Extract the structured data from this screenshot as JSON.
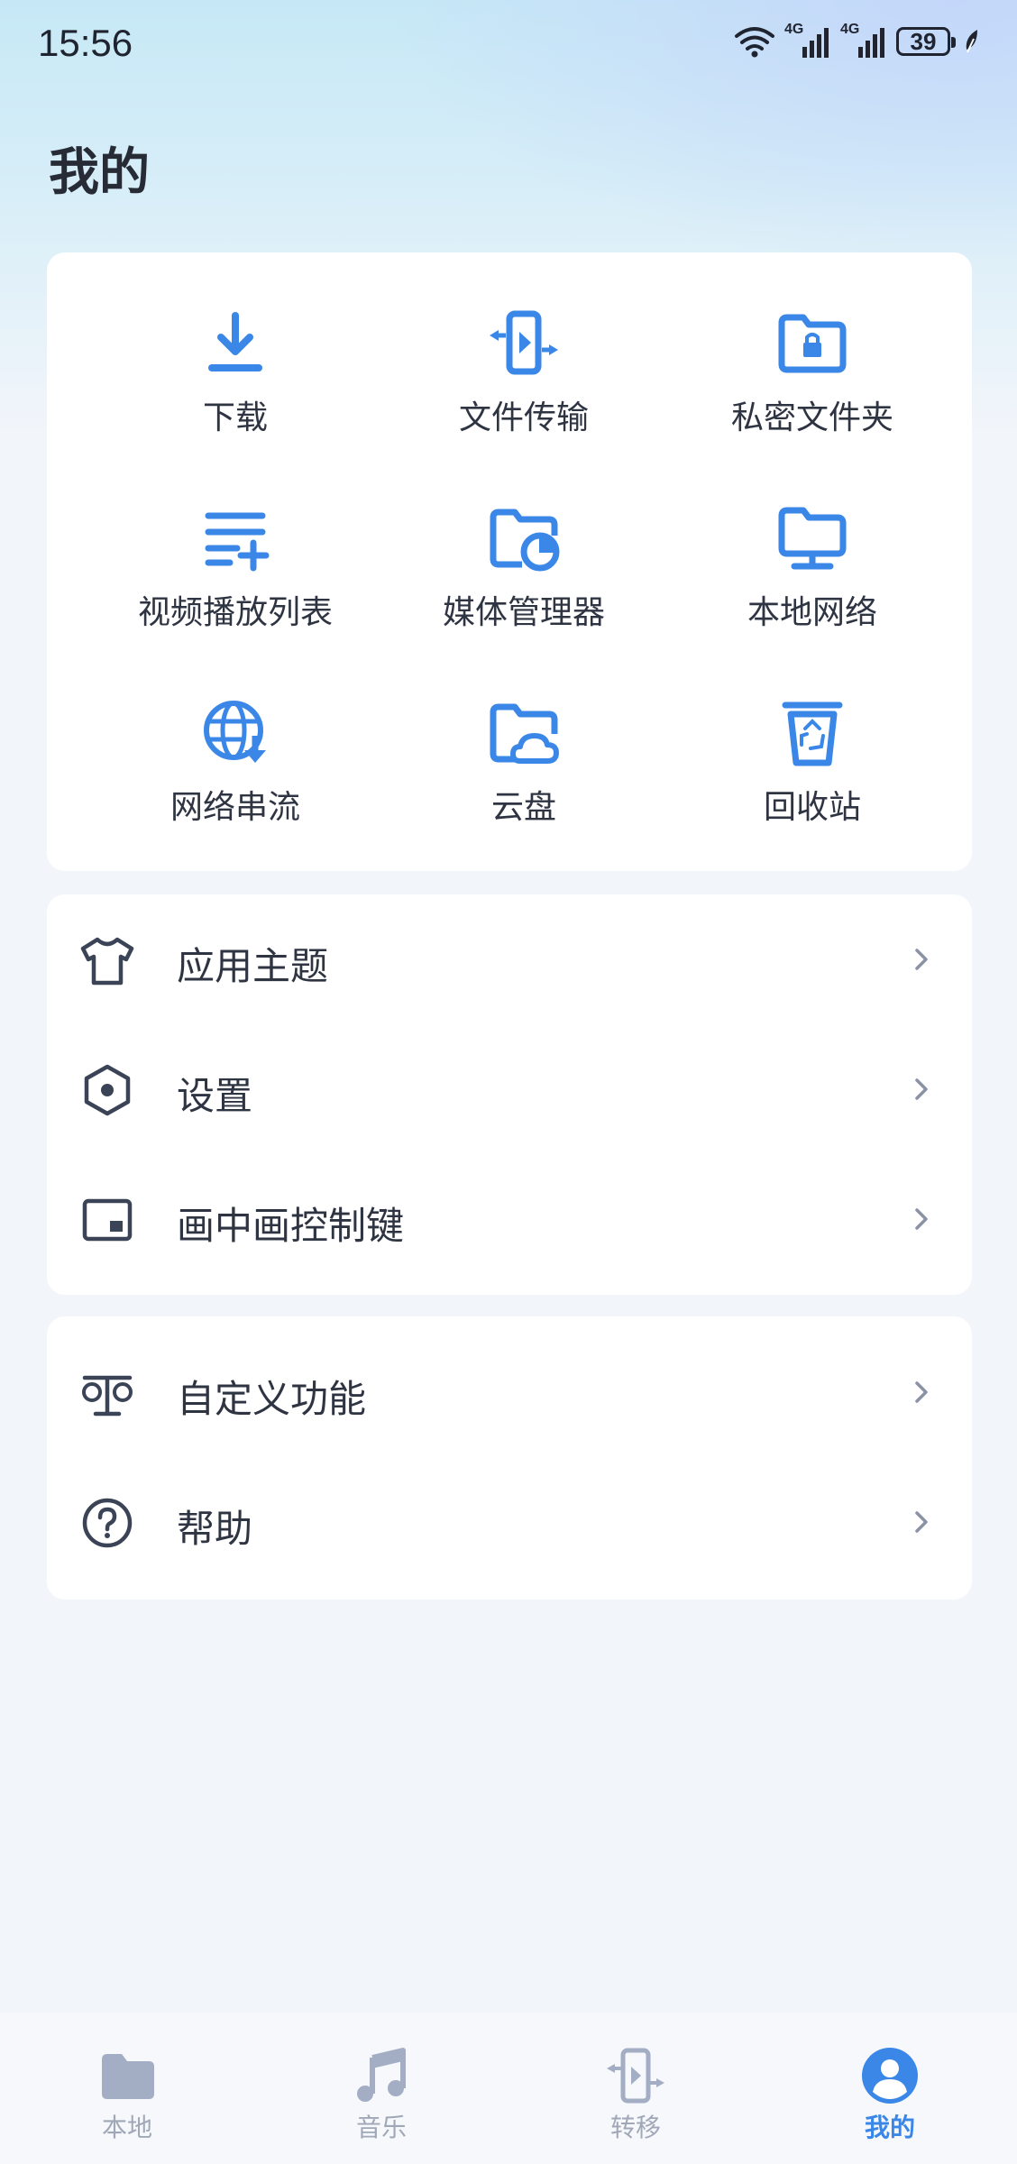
{
  "status_bar": {
    "time": "15:56",
    "battery": "39",
    "network_a": "4G",
    "network_b": "4G"
  },
  "page": {
    "title": "我的"
  },
  "colors": {
    "accent": "#3a87e8",
    "text": "#2e3442",
    "nav_inactive": "#a0a8b8"
  },
  "grid": {
    "items": [
      {
        "label": "下载",
        "icon": "download-icon"
      },
      {
        "label": "文件传输",
        "icon": "file-transfer-icon"
      },
      {
        "label": "私密文件夹",
        "icon": "private-folder-icon"
      },
      {
        "label": "视频播放列表",
        "icon": "playlist-icon"
      },
      {
        "label": "媒体管理器",
        "icon": "media-manager-icon"
      },
      {
        "label": "本地网络",
        "icon": "local-network-icon"
      },
      {
        "label": "网络串流",
        "icon": "network-stream-icon"
      },
      {
        "label": "云盘",
        "icon": "cloud-drive-icon"
      },
      {
        "label": "回收站",
        "icon": "recycle-bin-icon"
      }
    ]
  },
  "settings": {
    "items": [
      {
        "label": "应用主题",
        "icon": "shirt-icon"
      },
      {
        "label": "设置",
        "icon": "hexagon-gear-icon"
      },
      {
        "label": "画中画控制键",
        "icon": "pip-icon"
      }
    ]
  },
  "more": {
    "items": [
      {
        "label": "自定义功能",
        "icon": "balance-icon"
      },
      {
        "label": "帮助",
        "icon": "help-icon"
      }
    ]
  },
  "bottom_nav": {
    "items": [
      {
        "label": "本地",
        "icon": "folder-icon",
        "active": false
      },
      {
        "label": "音乐",
        "icon": "music-icon",
        "active": false
      },
      {
        "label": "转移",
        "icon": "transfer-icon",
        "active": false
      },
      {
        "label": "我的",
        "icon": "profile-icon",
        "active": true
      }
    ]
  }
}
